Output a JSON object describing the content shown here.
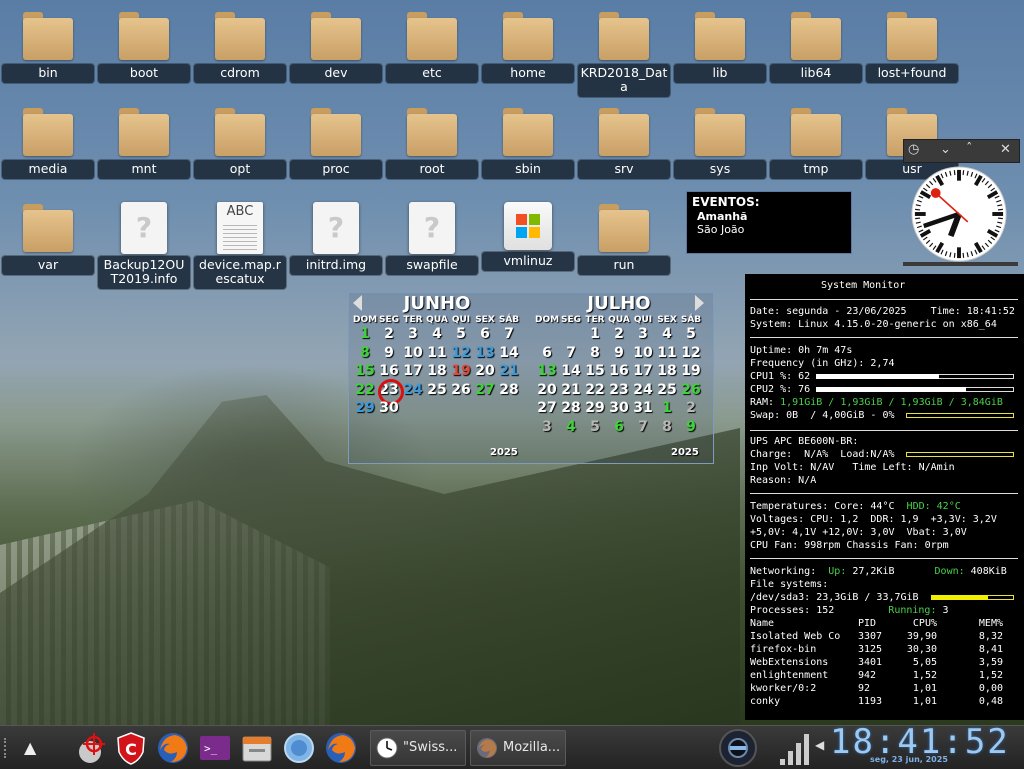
{
  "desktop_icons": [
    {
      "label": "bin",
      "kind": "folder"
    },
    {
      "label": "boot",
      "kind": "folder"
    },
    {
      "label": "cdrom",
      "kind": "folder"
    },
    {
      "label": "dev",
      "kind": "folder"
    },
    {
      "label": "etc",
      "kind": "folder"
    },
    {
      "label": "home",
      "kind": "folder"
    },
    {
      "label": "KRD2018_Data",
      "kind": "folder"
    },
    {
      "label": "lib",
      "kind": "folder"
    },
    {
      "label": "lib64",
      "kind": "folder"
    },
    {
      "label": "lost+found",
      "kind": "folder"
    },
    {
      "label": "media",
      "kind": "folder"
    },
    {
      "label": "mnt",
      "kind": "folder"
    },
    {
      "label": "opt",
      "kind": "folder"
    },
    {
      "label": "proc",
      "kind": "folder"
    },
    {
      "label": "root",
      "kind": "folder"
    },
    {
      "label": "sbin",
      "kind": "folder"
    },
    {
      "label": "srv",
      "kind": "folder"
    },
    {
      "label": "sys",
      "kind": "folder"
    },
    {
      "label": "tmp",
      "kind": "folder"
    },
    {
      "label": "usr",
      "kind": "folder"
    },
    {
      "label": "var",
      "kind": "folder"
    },
    {
      "label": "Backup12OUT2019.info",
      "kind": "file"
    },
    {
      "label": "device.map.rescatux",
      "kind": "doc"
    },
    {
      "label": "initrd.img",
      "kind": "file"
    },
    {
      "label": "swapfile",
      "kind": "file"
    },
    {
      "label": "vmlinuz",
      "kind": "exe"
    },
    {
      "label": "run",
      "kind": "folder"
    }
  ],
  "events": {
    "title": "EVENTOS:",
    "day": "Amanhã",
    "event": "São João"
  },
  "clock_widget": {
    "hour": 18,
    "minute": 41,
    "second": 52
  },
  "calendar": {
    "months": [
      {
        "name": "JUNHO",
        "year": "2025",
        "weekdays": [
          "DOM",
          "SEG",
          "TER",
          "QUA",
          "QUI",
          "SEX",
          "SÁB"
        ],
        "days": [
          {
            "d": "1",
            "c": "g"
          },
          {
            "d": "2"
          },
          {
            "d": "3"
          },
          {
            "d": "4"
          },
          {
            "d": "5"
          },
          {
            "d": "6"
          },
          {
            "d": "7"
          },
          {
            "d": "8",
            "c": "g"
          },
          {
            "d": "9"
          },
          {
            "d": "10"
          },
          {
            "d": "11"
          },
          {
            "d": "12",
            "c": "bl"
          },
          {
            "d": "13",
            "c": "bl"
          },
          {
            "d": "14"
          },
          {
            "d": "15",
            "c": "g"
          },
          {
            "d": "16"
          },
          {
            "d": "17"
          },
          {
            "d": "18"
          },
          {
            "d": "19",
            "c": "r"
          },
          {
            "d": "20"
          },
          {
            "d": "21",
            "c": "bl"
          },
          {
            "d": "22",
            "c": "g"
          },
          {
            "d": "23",
            "c": "today"
          },
          {
            "d": "24",
            "c": "bl"
          },
          {
            "d": "25"
          },
          {
            "d": "26"
          },
          {
            "d": "27",
            "c": "g"
          },
          {
            "d": "28"
          },
          {
            "d": "29",
            "c": "bl"
          },
          {
            "d": "30"
          }
        ]
      },
      {
        "name": "JULHO",
        "year": "2025",
        "weekdays": [
          "DOM",
          "SEG",
          "TER",
          "QUA",
          "QUI",
          "SEX",
          "SÁB"
        ],
        "days": [
          {
            "d": ""
          },
          {
            "d": ""
          },
          {
            "d": "1"
          },
          {
            "d": "2"
          },
          {
            "d": "3"
          },
          {
            "d": "4"
          },
          {
            "d": "5"
          },
          {
            "d": "6"
          },
          {
            "d": "7"
          },
          {
            "d": "8"
          },
          {
            "d": "9"
          },
          {
            "d": "10"
          },
          {
            "d": "11"
          },
          {
            "d": "12"
          },
          {
            "d": "13",
            "c": "g"
          },
          {
            "d": "14"
          },
          {
            "d": "15"
          },
          {
            "d": "16"
          },
          {
            "d": "17"
          },
          {
            "d": "18"
          },
          {
            "d": "19"
          },
          {
            "d": "20"
          },
          {
            "d": "21"
          },
          {
            "d": "22"
          },
          {
            "d": "23"
          },
          {
            "d": "24"
          },
          {
            "d": "25"
          },
          {
            "d": "26",
            "c": "g"
          },
          {
            "d": "27"
          },
          {
            "d": "28"
          },
          {
            "d": "29"
          },
          {
            "d": "30"
          },
          {
            "d": "31"
          },
          {
            "d": "1",
            "c": "g"
          },
          {
            "d": "2",
            "c": "dim"
          },
          {
            "d": "3",
            "c": "dim"
          },
          {
            "d": "4",
            "c": "g"
          },
          {
            "d": "5",
            "c": "dim"
          },
          {
            "d": "6",
            "c": "g"
          },
          {
            "d": "7",
            "c": "dim"
          },
          {
            "d": "8",
            "c": "dim"
          },
          {
            "d": "9",
            "c": "g"
          }
        ]
      }
    ]
  },
  "conky": {
    "title": "System Monitor",
    "date": "Date: segunda - 23/06/2025    Time: 18:41:52",
    "system": "System: Linux 4.15.0-20-generic on x86_64",
    "uptime": "Uptime: 0h 7m 47s",
    "freq": "Frequency (in GHz): 2,74",
    "cpu1": "CPU1 %: 62",
    "cpu1_pct": 62,
    "cpu2": "CPU2 %: 76",
    "cpu2_pct": 76,
    "ram_label": "RAM: ",
    "ram": "1,91GiB / 1,93GiB / 1,93GiB / 3,84GiB",
    "swap": "Swap: 0B  / 4,00GiB - 0%",
    "swap_pct": 0,
    "ups": "UPS APC BE600N-BR:",
    "charge": "Charge:  N/A%  Load:N/A%",
    "inp": "Inp Volt: N/AV   Time Left: N/Amin",
    "reason": "Reason: N/A",
    "temps_a": "Temperatures: Core: 44°C  ",
    "temps_hdd": "HDD: 42°C",
    "volt1": "Voltages: CPU: 1,2  DDR: 1,9  +3,3V: 3,2V",
    "volt2": "+5,0V: 4,1V +12,0V: 3,0V  Vbat: 3,0V",
    "fan": "CPU Fan: 998rpm Chassis Fan: 0rpm",
    "net_label": "Networking:  ",
    "up_label": "Up: ",
    "up": "27,2KiB",
    "down_label": "Down: ",
    "down": "408KiB",
    "fs": "File systems:",
    "fs_line": "/dev/sda3: 23,3GiB / 33,7GiB",
    "fs_pct": 69,
    "procs": "Processes: 152",
    "running_label": "Running: ",
    "running": "3",
    "proc_header": [
      "Name",
      "PID",
      "CPU%",
      "MEM%"
    ],
    "processes": [
      [
        "Isolated Web Co",
        "3307",
        "39,90",
        "8,32"
      ],
      [
        "firefox-bin",
        "3125",
        "30,30",
        "8,41"
      ],
      [
        "WebExtensions",
        "3401",
        "5,05",
        "3,59"
      ],
      [
        "enlightenment",
        "942",
        "1,52",
        "1,52"
      ],
      [
        "kworker/0:2",
        "92",
        "1,01",
        "0,00"
      ],
      [
        "conky",
        "1193",
        "1,01",
        "0,48"
      ]
    ]
  },
  "taskbar": {
    "tasks": [
      {
        "label": "\"Swiss..."
      },
      {
        "label": "Mozilla..."
      }
    ],
    "time": "18:41:52",
    "date": "seg, 23 jun, 2025"
  }
}
